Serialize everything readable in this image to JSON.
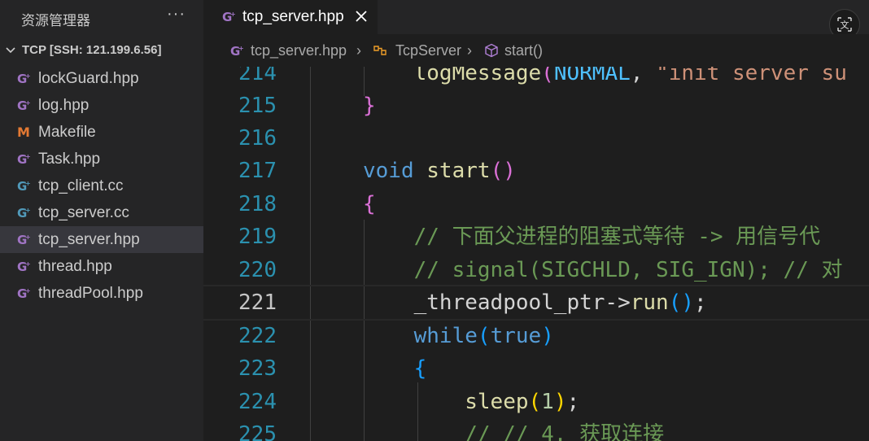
{
  "sidebar": {
    "title": "资源管理器",
    "more": "···",
    "section_label": "TCP [SSH: 121.199.6.56]",
    "files": [
      {
        "name": "lockGuard.hpp",
        "icon": "cpp-header-icon"
      },
      {
        "name": "log.hpp",
        "icon": "cpp-header-icon"
      },
      {
        "name": "Makefile",
        "icon": "makefile-icon"
      },
      {
        "name": "Task.hpp",
        "icon": "cpp-header-icon"
      },
      {
        "name": "tcp_client.cc",
        "icon": "cpp-source-icon"
      },
      {
        "name": "tcp_server.cc",
        "icon": "cpp-source-icon"
      },
      {
        "name": "tcp_server.hpp",
        "icon": "cpp-header-icon",
        "selected": true
      },
      {
        "name": "thread.hpp",
        "icon": "cpp-header-icon"
      },
      {
        "name": "threadPool.hpp",
        "icon": "cpp-header-icon"
      }
    ]
  },
  "tabs": [
    {
      "label": "tcp_server.hpp",
      "active": true
    }
  ],
  "breadcrumb": {
    "file": "tcp_server.hpp",
    "class": "TcpServer",
    "method": "start()"
  },
  "editor": {
    "current_line": 221,
    "lines": [
      {
        "num": "214",
        "text": "    logMessage(NORMAL, \"init server su"
      },
      {
        "num": "215",
        "text": "}"
      },
      {
        "num": "216",
        "text": ""
      },
      {
        "num": "217",
        "text": "void start()"
      },
      {
        "num": "218",
        "text": "{"
      },
      {
        "num": "219",
        "text": "    // 下面父进程的阻塞式等待 -> 用信号代"
      },
      {
        "num": "220",
        "text": "    // signal(SIGCHLD, SIG_IGN); // 对"
      },
      {
        "num": "221",
        "text": "    _threadpool_ptr->run();"
      },
      {
        "num": "222",
        "text": "    while(true)"
      },
      {
        "num": "223",
        "text": "    {"
      },
      {
        "num": "224",
        "text": "        sleep(1);"
      },
      {
        "num": "225",
        "text": "        // // 4. 获取连接"
      }
    ]
  },
  "colors": {
    "accent_purple": "#a074c4",
    "makefile_orange": "#e37933",
    "line_number": "#2b91af",
    "keyword": "#569cd6",
    "comment": "#6a9955"
  }
}
